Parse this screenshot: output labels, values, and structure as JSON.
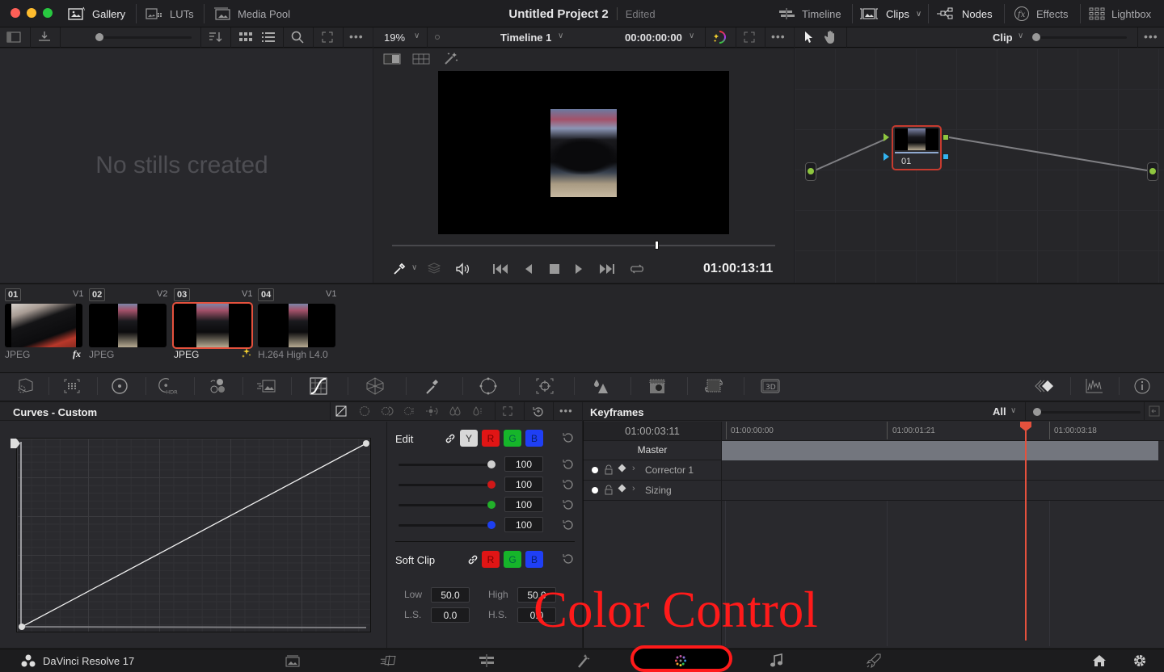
{
  "topbar": {
    "gallery": "Gallery",
    "luts": "LUTs",
    "media_pool": "Media Pool",
    "project_title": "Untitled Project 2",
    "project_status": "Edited",
    "timeline": "Timeline",
    "clips": "Clips",
    "nodes": "Nodes",
    "effects": "Effects",
    "lightbox": "Lightbox"
  },
  "gallery_panel": {
    "empty_text": "No stills created"
  },
  "viewer": {
    "zoom": "19%",
    "timeline_name": "Timeline 1",
    "timecode_top": "00:00:00:00",
    "timecode_current": "01:00:13:11",
    "scrub_position": 0.69
  },
  "nodes_panel": {
    "mode": "Clip",
    "node_label": "01"
  },
  "clips": [
    {
      "num": "01",
      "track": "V1",
      "format": "JPEG",
      "badge": "fx",
      "selected": false
    },
    {
      "num": "02",
      "track": "V2",
      "format": "JPEG",
      "badge": "",
      "selected": false
    },
    {
      "num": "03",
      "track": "V1",
      "format": "JPEG",
      "badge": "sparkle",
      "selected": true
    },
    {
      "num": "04",
      "track": "V1",
      "format": "H.264 High L4.0",
      "badge": "",
      "selected": false
    }
  ],
  "curves": {
    "title": "Curves - Custom",
    "edit_label": "Edit",
    "channels": [
      "Y",
      "R",
      "G",
      "B"
    ],
    "intensity": [
      {
        "channel": "Y",
        "value": "100",
        "color": "#d0d0d0"
      },
      {
        "channel": "R",
        "value": "100",
        "color": "#d01818"
      },
      {
        "channel": "G",
        "value": "100",
        "color": "#22b02a"
      },
      {
        "channel": "B",
        "value": "100",
        "color": "#1d3ff0"
      }
    ],
    "soft_clip_label": "Soft Clip",
    "soft_clip_channels": [
      "R",
      "G",
      "B"
    ],
    "low_label": "Low",
    "low_value": "50.0",
    "high_label": "High",
    "high_value": "50.0",
    "ls_label": "L.S.",
    "ls_value": "0.0",
    "hs_label": "H.S.",
    "hs_value": "0.0"
  },
  "keyframes": {
    "title": "Keyframes",
    "filter": "All",
    "current_tc": "01:00:03:11",
    "ruler": [
      "01:00:00:00",
      "01:00:01:21",
      "01:00:03:18"
    ],
    "master_label": "Master",
    "tracks": [
      "Corrector 1",
      "Sizing"
    ]
  },
  "bottombar": {
    "app_name": "DaVinci Resolve 17"
  },
  "annotation": {
    "text": "Color Control",
    "color": "#ff1a1a"
  },
  "colors": {
    "accent_red": "#e5513d",
    "playhead": "#e5513d",
    "node_green": "#8ec63f",
    "node_blue": "#33b3f0"
  }
}
